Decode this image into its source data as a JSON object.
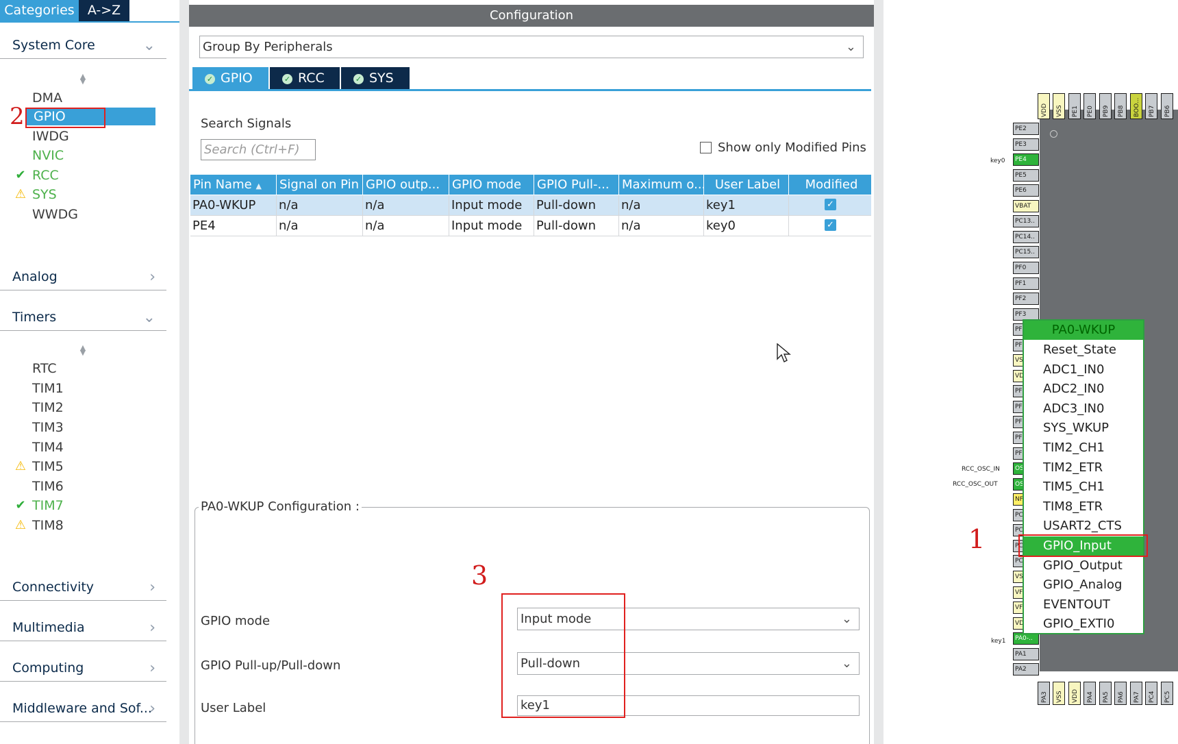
{
  "sidebar": {
    "tab_categories": "Categories",
    "tab_az": "A->Z",
    "sections": {
      "system_core": "System Core",
      "analog": "Analog",
      "timers": "Timers",
      "connectivity": "Connectivity",
      "multimedia": "Multimedia",
      "computing": "Computing",
      "middleware": "Middleware and Sof..."
    },
    "system_core_items": [
      "DMA",
      "GPIO",
      "IWDG",
      "NVIC",
      "RCC",
      "SYS",
      "WWDG"
    ],
    "timers_items": [
      "RTC",
      "TIM1",
      "TIM2",
      "TIM3",
      "TIM4",
      "TIM5",
      "TIM6",
      "TIM7",
      "TIM8"
    ],
    "annotation_2": "2"
  },
  "config": {
    "title": "Configuration",
    "group_by": "Group By Peripherals",
    "tabs": [
      "GPIO",
      "RCC",
      "SYS"
    ],
    "search_label": "Search Signals",
    "search_placeholder": "Search (Ctrl+F)",
    "show_modified": "Show only Modified Pins",
    "columns": [
      "Pin Name",
      "Signal on Pin",
      "GPIO outp...",
      "GPIO mode",
      "GPIO Pull-...",
      "Maximum o...",
      "User Label",
      "Modified"
    ],
    "rows": [
      [
        "PA0-WKUP",
        "n/a",
        "n/a",
        "Input mode",
        "Pull-down",
        "n/a",
        "key1"
      ],
      [
        "PE4",
        "n/a",
        "n/a",
        "Input mode",
        "Pull-down",
        "n/a",
        "key0"
      ]
    ],
    "pin_config_legend": "PA0-WKUP Configuration :",
    "gpio_mode_label": "GPIO mode",
    "gpio_mode_value": "Input mode",
    "pull_label": "GPIO Pull-up/Pull-down",
    "pull_value": "Pull-down",
    "user_label_label": "User Label",
    "user_label_value": "key1",
    "annotation_3": "3"
  },
  "chip": {
    "top_pins": [
      "VDD",
      "VSS",
      "PE1",
      "PE0",
      "PB9",
      "PB8",
      "BOO...",
      "PB7",
      "PB6"
    ],
    "left_pins": [
      "PE2",
      "PE3",
      "PE4",
      "PE5",
      "PE6",
      "VBAT",
      "PC13..",
      "PC14..",
      "PC15..",
      "PF0",
      "PF1",
      "PF2",
      "PF3",
      "PF",
      "PF",
      "VS",
      "VD",
      "PF",
      "PF",
      "PF",
      "PF",
      "PF",
      "OS",
      "OS",
      "NF",
      "PC",
      "PC",
      "PC",
      "PC",
      "VS",
      "VF",
      "VF",
      "VD",
      "PA0-..",
      "PA1",
      "PA2"
    ],
    "bottom_pins": [
      "PA3",
      "VSS",
      "VDD",
      "PA4",
      "PA5",
      "PA6",
      "PA7",
      "PC4",
      "PC5"
    ],
    "signal_labels": {
      "key0": "key0",
      "rcc_osc_in": "RCC_OSC_IN",
      "rcc_osc_out": "RCC_OSC_OUT",
      "key1": "key1"
    },
    "popup_title": "PA0-WKUP",
    "popup_items": [
      "Reset_State",
      "ADC1_IN0",
      "ADC2_IN0",
      "ADC3_IN0",
      "SYS_WKUP",
      "TIM2_CH1",
      "TIM2_ETR",
      "TIM5_CH1",
      "TIM8_ETR",
      "USART2_CTS",
      "GPIO_Input",
      "GPIO_Output",
      "GPIO_Analog",
      "EVENTOUT",
      "GPIO_EXTI0"
    ],
    "annotation_1": "1"
  },
  "colors": {
    "accent": "#39a0d8",
    "dark_tab": "#0d2a4a",
    "pin_green": "#2fb33b",
    "annotation_red": "#e0201e"
  }
}
